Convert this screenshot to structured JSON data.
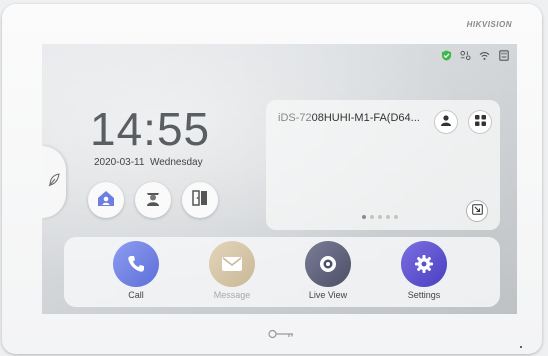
{
  "brand": "HIKVISION",
  "status_icons": [
    "shield-check-icon",
    "camera-link-icon",
    "wifi-icon",
    "sd-card-icon"
  ],
  "colors": {
    "shield": "#3db84a",
    "call": "#6d7fe0",
    "message": "#d4c4a8",
    "liveview": "#5c5f7a",
    "settings": "#5a4fcf"
  },
  "clock": {
    "time": "14:55",
    "date": "2020-03-11",
    "weekday": "Wednesday"
  },
  "side_tab_icon": "leaf-icon",
  "quick_buttons": [
    "home-user-icon",
    "guard-icon",
    "door-icon"
  ],
  "card": {
    "device_prefix": "iDS-72",
    "device_name": "08HUHI-M1-FA(D64...",
    "pager_dots": 5,
    "active_dot": 0
  },
  "dock": {
    "call_label": "Call",
    "message_label": "Message",
    "liveview_label": "Live View",
    "settings_label": "Settings"
  }
}
